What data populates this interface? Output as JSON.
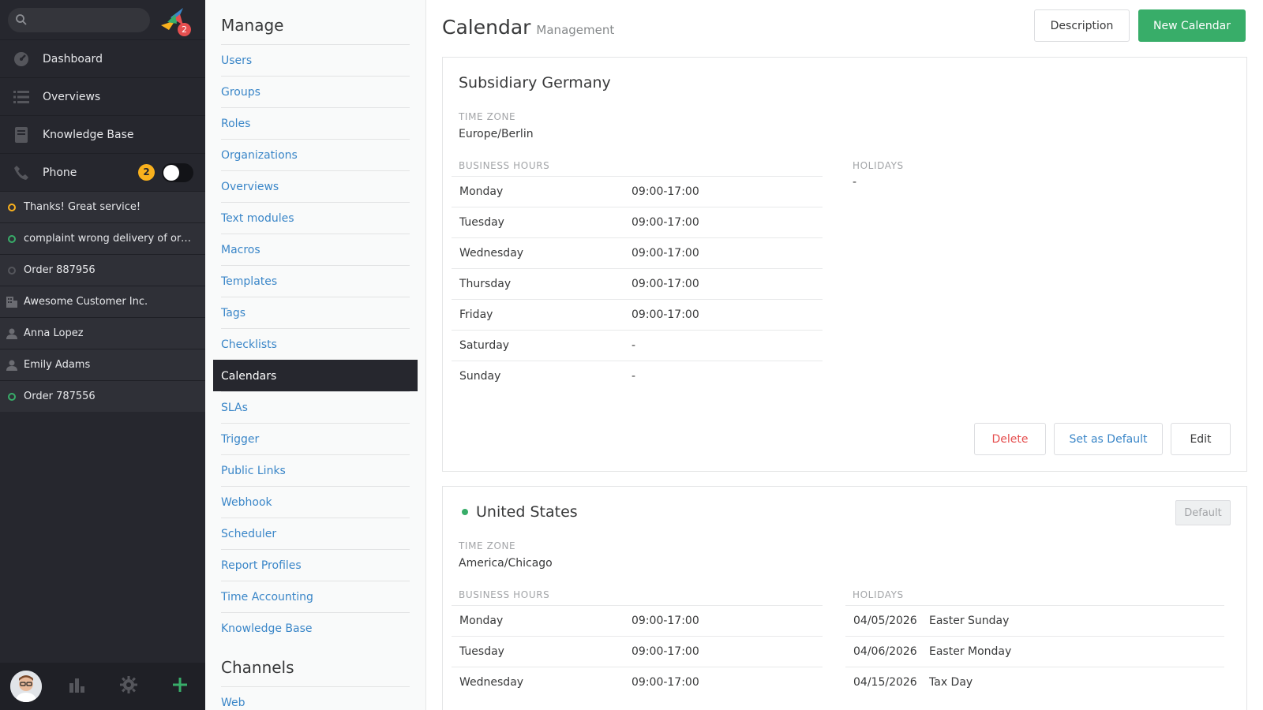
{
  "nav": {
    "search_placeholder": "",
    "logo_badge": "2",
    "main_items": [
      {
        "label": "Dashboard",
        "icon": "dashboard-icon"
      },
      {
        "label": "Overviews",
        "icon": "list-icon"
      },
      {
        "label": "Knowledge Base",
        "icon": "book-icon"
      },
      {
        "label": "Phone",
        "icon": "phone-icon",
        "count": "2"
      }
    ],
    "tasks": [
      {
        "label": "Thanks! Great service!",
        "icon": "ticket-open-icon",
        "status_color": "#f9b11d"
      },
      {
        "label": "complaint wrong delivery of order",
        "icon": "ticket-open-icon",
        "status_color": "#38ad69"
      },
      {
        "label": "Order 887956",
        "icon": "ticket-closed-icon",
        "status_color": "#55565c"
      },
      {
        "label": "Awesome Customer Inc.",
        "icon": "organization-icon"
      },
      {
        "label": "Anna Lopez",
        "icon": "user-icon"
      },
      {
        "label": "Emily Adams",
        "icon": "user-icon"
      },
      {
        "label": "Order 787556",
        "icon": "ticket-open-icon",
        "status_color": "#38ad69"
      }
    ]
  },
  "manage": {
    "title": "Manage",
    "items": [
      "Users",
      "Groups",
      "Roles",
      "Organizations",
      "Overviews",
      "Text modules",
      "Macros",
      "Templates",
      "Tags",
      "Checklists",
      "Calendars",
      "SLAs",
      "Trigger",
      "Public Links",
      "Webhook",
      "Scheduler",
      "Report Profiles",
      "Time Accounting",
      "Knowledge Base"
    ],
    "active": "Calendars",
    "channels_title": "Channels",
    "channel_items": [
      "Web"
    ]
  },
  "header": {
    "title": "Calendar",
    "subtitle": "Management",
    "description_button": "Description",
    "new_button": "New Calendar"
  },
  "calendars": [
    {
      "name": "Subsidiary Germany",
      "timezone_label": "TIME ZONE",
      "timezone": "Europe/Berlin",
      "hours_label": "BUSINESS HOURS",
      "holidays_label": "HOLIDAYS",
      "hours": [
        {
          "day": "Monday",
          "time": "09:00-17:00"
        },
        {
          "day": "Tuesday",
          "time": "09:00-17:00"
        },
        {
          "day": "Wednesday",
          "time": "09:00-17:00"
        },
        {
          "day": "Thursday",
          "time": "09:00-17:00"
        },
        {
          "day": "Friday",
          "time": "09:00-17:00"
        },
        {
          "day": "Saturday",
          "time": "-"
        },
        {
          "day": "Sunday",
          "time": "-"
        }
      ],
      "holidays_empty": "-",
      "actions": {
        "delete": "Delete",
        "set_default": "Set as Default",
        "edit": "Edit"
      }
    },
    {
      "name": "United States",
      "default_badge": "Default",
      "timezone_label": "TIME ZONE",
      "timezone": "America/Chicago",
      "hours_label": "BUSINESS HOURS",
      "holidays_label": "HOLIDAYS",
      "hours": [
        {
          "day": "Monday",
          "time": "09:00-17:00"
        },
        {
          "day": "Tuesday",
          "time": "09:00-17:00"
        },
        {
          "day": "Wednesday",
          "time": "09:00-17:00"
        }
      ],
      "holidays": [
        {
          "date": "04/05/2026",
          "name": "Easter Sunday"
        },
        {
          "date": "04/06/2026",
          "name": "Easter Monday"
        },
        {
          "date": "04/15/2026",
          "name": "Tax Day"
        }
      ]
    }
  ],
  "colors": {
    "nav_bg": "#26272e",
    "accent_green": "#38ad69",
    "link_blue": "#3a86c8",
    "danger_red": "#e54f4f",
    "badge_yellow": "#f9b11d"
  }
}
